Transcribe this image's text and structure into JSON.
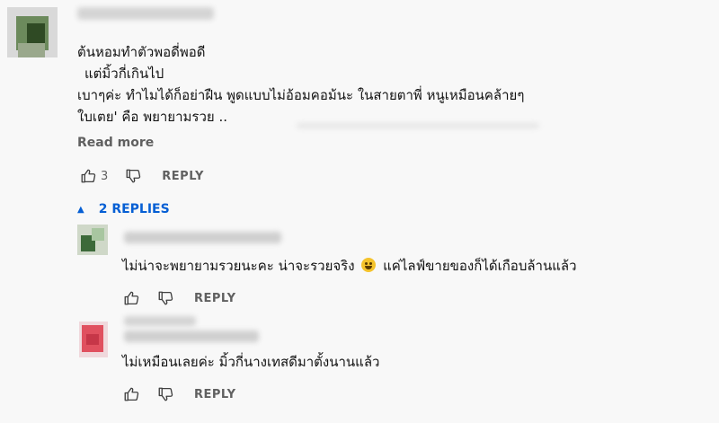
{
  "comment": {
    "lines": [
      "ต้นหอมทำตัวพอดี่พอดี",
      "แต่มิ้วกี่เกินไป",
      "เบาๆค่ะ ทำไมได้ก็อย่าฝืน พูดแบบไม่อ้อมคอม้นะ ในสายตาพี่ หนูเหมือนคล้ายๆ",
      "ใบเตย' คือ พยายามรวย .."
    ],
    "read_more": "Read more",
    "like_count": "3",
    "reply_label": "REPLY"
  },
  "replies_toggle": {
    "arrow": "▲",
    "label": "2 REPLIES"
  },
  "replies": [
    {
      "text_before": "ไม่น่าจะพยายามรวยนะคะ น่าจะรวยจริง",
      "emoji": "grinning-sweat-face",
      "text_after": "แค่ไลฟ์ขายของก็ได้เกือบล้านแล้ว",
      "reply_label": "REPLY"
    },
    {
      "text": "ไม่เหมือนเลยค่ะ มิ้วกี่นางเทสดีมาตั้งนานแล้ว",
      "reply_label": "REPLY"
    }
  ],
  "colors": {
    "accent": "#065fd4",
    "secondary_text": "#606060"
  }
}
